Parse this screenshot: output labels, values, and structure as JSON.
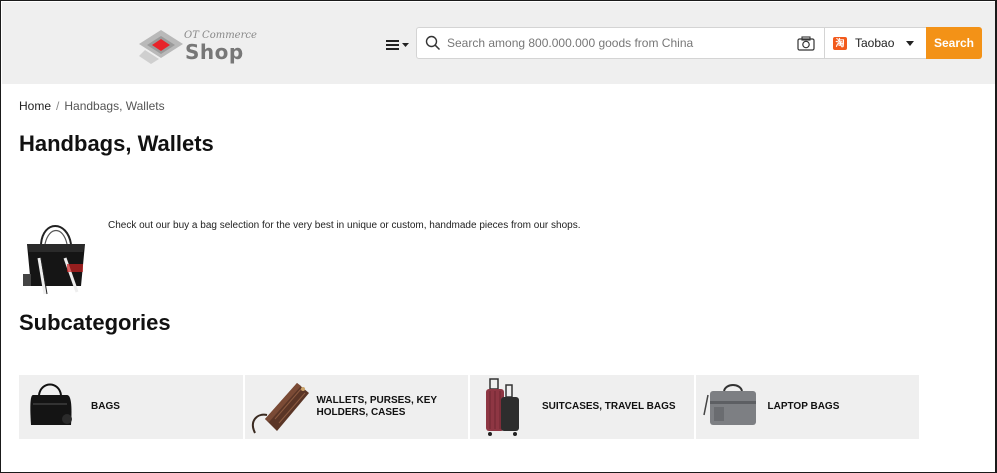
{
  "header": {
    "logo": {
      "top_text": "OT Commerce",
      "main_text": "Shop"
    },
    "menu_icon": "hamburger-menu-icon",
    "search": {
      "placeholder": "Search among 800.000.000 goods from China",
      "value": "",
      "provider_badge": "淘",
      "provider": "Taobao",
      "button_label": "Search"
    }
  },
  "breadcrumb": {
    "home": "Home",
    "separator": "/",
    "current": "Handbags, Wallets"
  },
  "page": {
    "title": "Handbags, Wallets",
    "description": "Check out our buy a bag selection for the very best in unique or custom, handmade pieces from our shops.",
    "subcategories_title": "Subcategories"
  },
  "subcategories": [
    {
      "label": "BAGS"
    },
    {
      "label": "WALLETS, PURSES, KEY HOLDERS, CASES"
    },
    {
      "label": "SUITCASES, TRAVEL BAGS"
    },
    {
      "label": "LAPTOP BAGS"
    }
  ],
  "colors": {
    "accent": "#f39217",
    "header_bg": "#efefef",
    "logo_red": "#e8232a",
    "tile_bg": "#efefef"
  }
}
